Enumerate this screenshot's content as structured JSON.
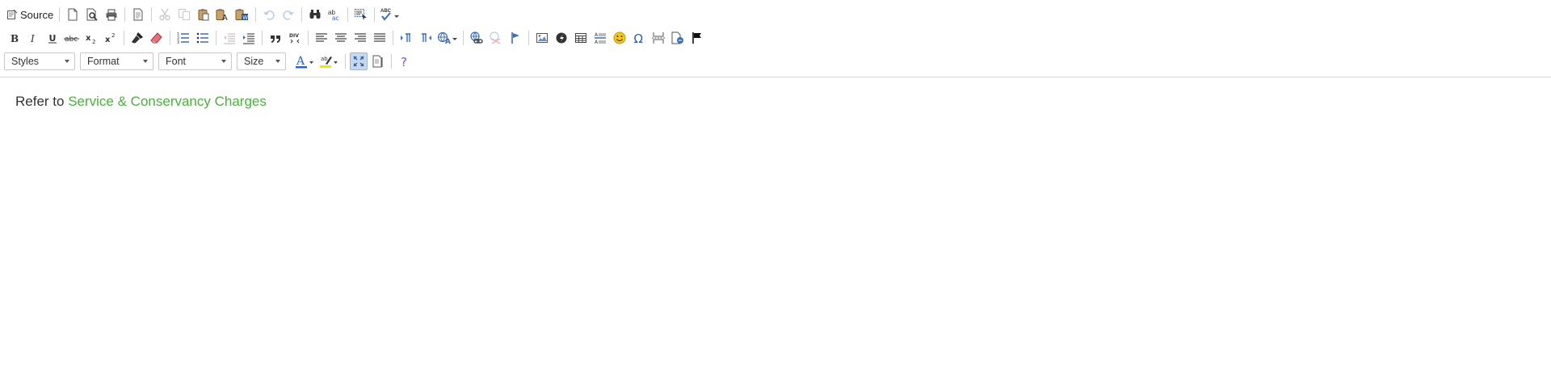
{
  "toolbar": {
    "source_label": "Source",
    "combos": {
      "styles": "Styles",
      "format": "Format",
      "font": "Font",
      "size": "Size"
    },
    "colors": {
      "active_bg": "#c8d7ea",
      "text_color_bar": "#2b66c2",
      "highlight_bar": "#f2e500",
      "link_green": "#4caf3f",
      "help_purple": "#8a4fc4"
    }
  },
  "content": {
    "prefix": "Refer to ",
    "link_text": "Service & Conservancy Charges"
  }
}
